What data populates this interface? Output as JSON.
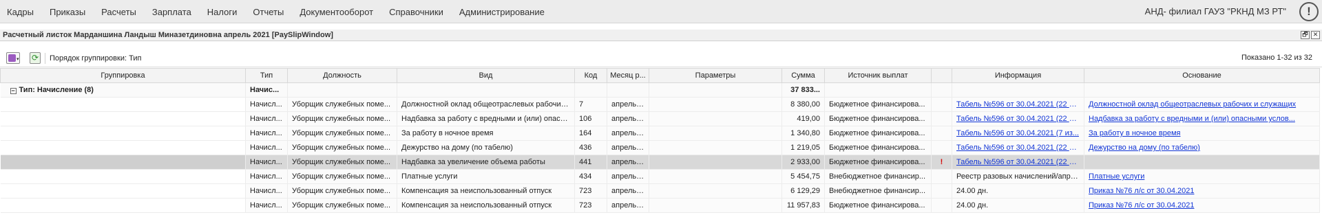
{
  "menu": [
    "Кадры",
    "Приказы",
    "Расчеты",
    "Зарплата",
    "Налоги",
    "Отчеты",
    "Документооборот",
    "Справочники",
    "Администрирование"
  ],
  "org_name": "АНД- филиал ГАУЗ \"РКНД МЗ РТ\"",
  "alert_glyph": "!",
  "window": {
    "title": "Расчетный листок Марданшина Ландыш Миназетдиновна апрель 2021 [PaySlipWindow]",
    "restore_glyph": "🗗",
    "close_glyph": "✕"
  },
  "toolbar": {
    "refresh_glyph": "⟳",
    "menu_arrow": "▾",
    "grouping_label": "Порядок группировки:",
    "grouping_value": "Тип",
    "shown": "Показано 1-32 из 32"
  },
  "table": {
    "columns": [
      "Группировка",
      "Тип",
      "Должность",
      "Вид",
      "Код",
      "Месяц р...",
      "Параметры",
      "Сумма",
      "Источник выплат",
      "",
      "Информация",
      "Основание"
    ],
    "group": {
      "toggle": "−",
      "label": "Тип: Начисление (8)",
      "type": "Начис...",
      "sum": "37 833..."
    },
    "rows": [
      {
        "type": "Начисл...",
        "position": "Уборщик служебных поме...",
        "kind": "Должностной оклад общеотраслевых рабочих и ...",
        "code": "7",
        "month": "апрель(...",
        "params": "",
        "sum": "8 380,00",
        "source": "Бюджетное финансирова...",
        "flag": "",
        "info": "Табель №596 от 30.04.2021 (22 и...",
        "basis": "Должностной оклад общеотраслевых рабочих и служащих"
      },
      {
        "type": "Начисл...",
        "position": "Уборщик служебных поме...",
        "kind": "Надбавка за работу с вредными и (или) опасны...",
        "code": "106",
        "month": "апрель(...",
        "params": "",
        "sum": "419,00",
        "source": "Бюджетное финансирова...",
        "flag": "",
        "info": "Табель №596 от 30.04.2021 (22 и...",
        "basis": "Надбавка за работу с вредными и (или) опасными услов..."
      },
      {
        "type": "Начисл...",
        "position": "Уборщик служебных поме...",
        "kind": "За работу в ночное время",
        "code": "164",
        "month": "апрель(...",
        "params": "",
        "sum": "1 340,80",
        "source": "Бюджетное финансирова...",
        "flag": "",
        "info": "Табель №596 от 30.04.2021 (7 из...",
        "basis": "За работу в ночное время"
      },
      {
        "type": "Начисл...",
        "position": "Уборщик служебных поме...",
        "kind": "Дежурство на дому (по табелю)",
        "code": "436",
        "month": "апрель(...",
        "params": "",
        "sum": "1 219,05",
        "source": "Бюджетное финансирова...",
        "flag": "",
        "info": "Табель №596 от 30.04.2021 (22 и...",
        "basis": "Дежурство на дому (по табелю)"
      },
      {
        "type": "Начисл...",
        "position": "Уборщик служебных поме...",
        "kind": "Надбавка за увеличение объема работы",
        "code": "441",
        "month": "апрель(...",
        "params": "",
        "sum": "2 933,00",
        "source": "Бюджетное финансирова...",
        "flag": "!",
        "info": "Табель №596 от 30.04.2021 (22 и...",
        "basis": ""
      },
      {
        "type": "Начисл...",
        "position": "Уборщик служебных поме...",
        "kind": "Платные услуги",
        "code": "434",
        "month": "апрель(...",
        "params": "",
        "sum": "5 454,75",
        "source": "Внебюджетное финансир...",
        "flag": "",
        "info": "Реестр разовых начислений/апре...",
        "basis": "Платные услуги"
      },
      {
        "type": "Начисл...",
        "position": "Уборщик служебных поме...",
        "kind": "Компенсация за неиспользованный отпуск",
        "code": "723",
        "month": "апрель(...",
        "params": "",
        "sum": "6 129,29",
        "source": "Внебюджетное финансир...",
        "flag": "",
        "info": "24.00 дн.",
        "basis": "Приказ №76 л/с от 30.04.2021"
      },
      {
        "type": "Начисл...",
        "position": "Уборщик служебных поме...",
        "kind": "Компенсация за неиспользованный отпуск",
        "code": "723",
        "month": "апрель(...",
        "params": "",
        "sum": "11 957,83",
        "source": "Бюджетное финансирова...",
        "flag": "",
        "info": "24.00 дн.",
        "basis": "Приказ №76 л/с от 30.04.2021"
      }
    ]
  }
}
